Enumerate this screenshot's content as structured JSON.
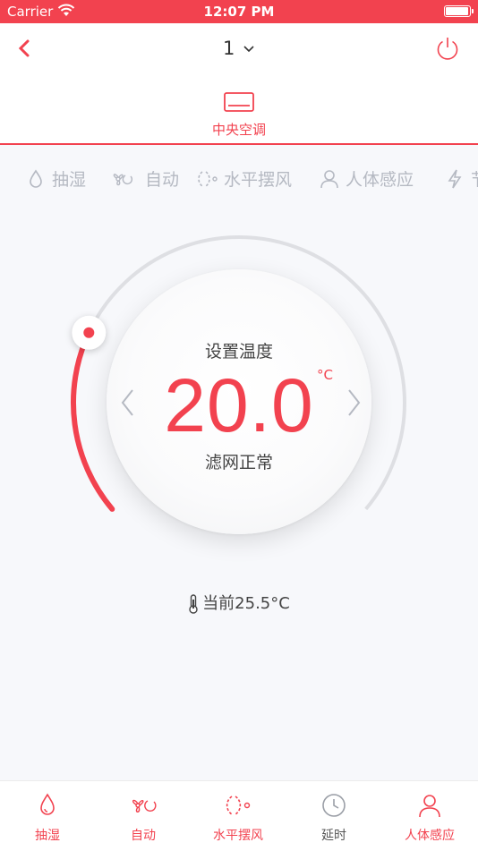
{
  "status_bar": {
    "carrier": "Carrier",
    "time": "12:07 PM",
    "battery_level": 0.9
  },
  "header": {
    "device_name": "1",
    "icons": {
      "back": "chevron-left-icon",
      "dropdown": "chevron-down-icon",
      "power": "power-icon"
    },
    "device_type_tab": {
      "label": "中央空调",
      "icon": "air-conditioner-icon"
    }
  },
  "mode_strip": [
    {
      "label": "抽湿",
      "icon": "droplet-icon"
    },
    {
      "label": "自动",
      "icon": "fan-auto-icon"
    },
    {
      "label": "水平摆风",
      "icon": "swing-icon"
    },
    {
      "label": "人体感应",
      "icon": "person-icon"
    },
    {
      "label": "节",
      "icon": "lightning-icon"
    }
  ],
  "thermostat": {
    "set_label": "设置温度",
    "set_temperature": "20.0",
    "unit": "°C",
    "filter_status": "滤网正常",
    "dial_level": 0.25
  },
  "current_temperature": "当前25.5°C",
  "bottom_tabs": [
    {
      "label": "抽湿",
      "icon": "droplet-icon",
      "active": true
    },
    {
      "label": "自动",
      "icon": "fan-auto-icon",
      "active": true
    },
    {
      "label": "水平摆风",
      "icon": "swing-icon",
      "active": true
    },
    {
      "label": "延时",
      "icon": "clock-icon",
      "active": false
    },
    {
      "label": "人体感应",
      "icon": "person-icon",
      "active": true
    }
  ],
  "colors": {
    "accent": "#f2424f",
    "inactive": "#b5b9c2",
    "text": "#444444",
    "background": "#f7f8fb"
  }
}
